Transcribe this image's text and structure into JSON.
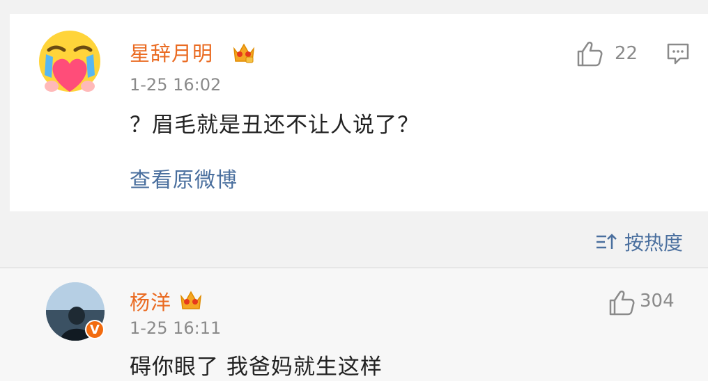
{
  "comment1": {
    "username": "星辞月明",
    "time": "1-25 16:02",
    "content": "？眉毛就是丑还不让人说了？",
    "likes": "22",
    "view_original": "查看原微博"
  },
  "sort": {
    "label": "按热度"
  },
  "comment2": {
    "username": "杨洋",
    "time": "1-25 16:11",
    "content": "碍你眼了 我爸妈就生这样",
    "likes": "304"
  },
  "icons": {
    "crown": "crown-icon",
    "like": "thumbs-up-icon",
    "comment": "comment-icon",
    "sort": "sort-icon",
    "verified": "verified-v-icon"
  },
  "colors": {
    "username": "#ea6b22",
    "link": "#4a6f9e",
    "meta": "#8a8a8a",
    "verified": "#f26b0f"
  }
}
